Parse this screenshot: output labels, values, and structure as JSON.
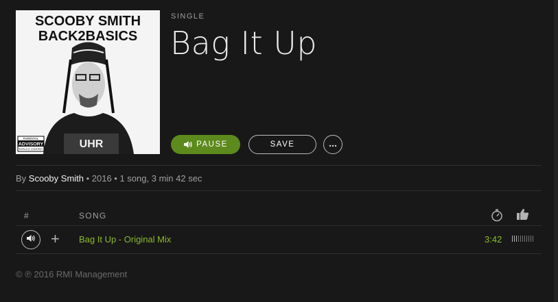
{
  "album": {
    "type_label": "SINGLE",
    "title": "Bag It Up",
    "cover_text_line1": "SCOOBY SMITH",
    "cover_text_line2": "BACK2BASICS",
    "advisory_line1": "PARENTAL",
    "advisory_line2": "ADVISORY",
    "advisory_line3": "EXPLICIT CONTENT"
  },
  "actions": {
    "pause_label": "PAUSE",
    "save_label": "SAVE",
    "more_icon": "ellipsis-icon"
  },
  "meta": {
    "by": "By ",
    "artist": "Scooby Smith",
    "details": " • 2016 • 1 song, 3 min 42 sec"
  },
  "tracklist": {
    "col_num": "#",
    "col_song": "SONG",
    "col_duration_icon": "stopwatch-icon",
    "col_popularity_icon": "thumbs-up-icon",
    "rows": [
      {
        "title": "Bag It Up - Original Mix",
        "duration": "3:42",
        "popularity": 0.3
      }
    ]
  },
  "footer": {
    "copyright": "© ℗ 2016 RMI Management"
  },
  "colors": {
    "accent": "#8bbc28",
    "pause_bg": "#5d8a1c",
    "bg": "#181818"
  }
}
